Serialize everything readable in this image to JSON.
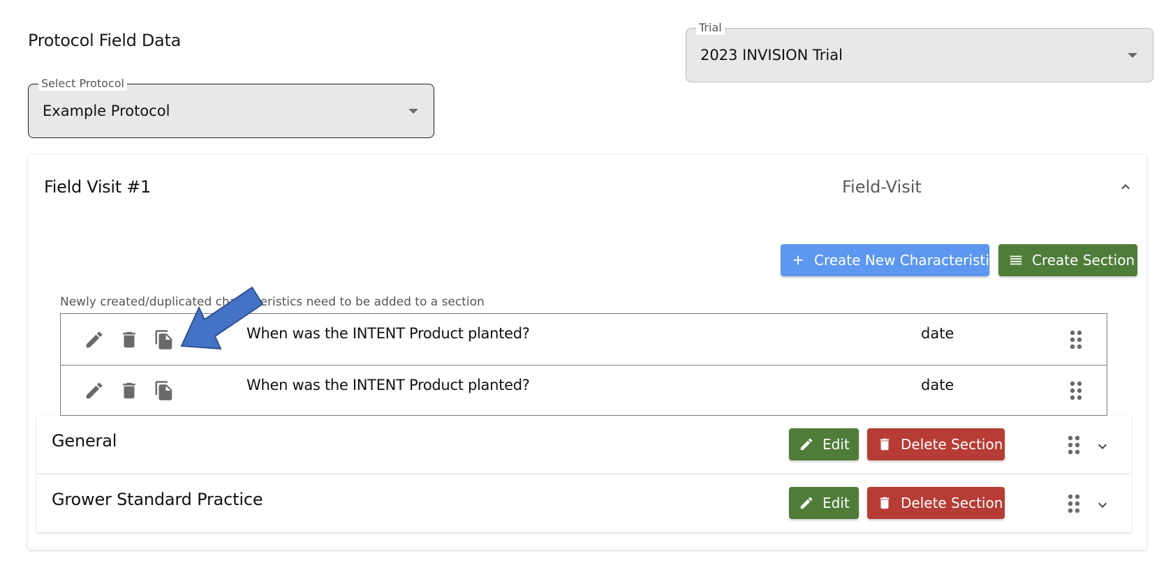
{
  "page": {
    "title": "Protocol Field Data"
  },
  "trial_select": {
    "label": "Trial",
    "value": "2023 INVISION Trial",
    "icon": "arrow-drop-down-icon"
  },
  "protocol_select": {
    "label": "Select Protocol",
    "value": "Example Protocol",
    "icon": "arrow-drop-down-icon"
  },
  "field_visit": {
    "title": "Field Visit #1",
    "type": "Field-Visit",
    "collapse_icon": "chevron-up-icon",
    "actions": {
      "create_characteristic": "Create New Characteristic",
      "create_section": "Create Section"
    },
    "notice": "Newly created/duplicated characteristics need to be added to a section",
    "characteristics": [
      {
        "question": "When was the INTENT Product planted?",
        "type": "date"
      },
      {
        "question": "When was the INTENT Product planted?",
        "type": "date"
      }
    ],
    "sections": [
      {
        "title": "General",
        "edit_label": "Edit",
        "delete_label": "Delete Section"
      },
      {
        "title": "Grower Standard Practice",
        "edit_label": "Edit",
        "delete_label": "Delete Section"
      }
    ]
  },
  "annotation": {
    "icon": "blue-arrow-pointer",
    "color": "#4472c4"
  },
  "colors": {
    "primary": "#5d97ef",
    "success": "#4f7c39",
    "danger": "#b63c35"
  }
}
